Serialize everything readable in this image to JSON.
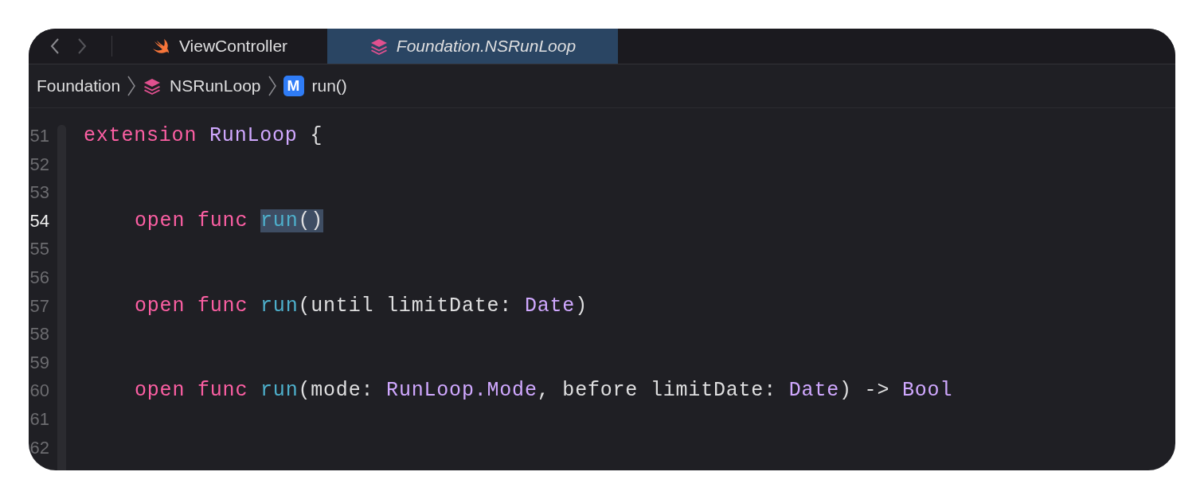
{
  "tab_bar": {
    "tabs": [
      {
        "label": "ViewController",
        "kind": "swift",
        "selected": false,
        "preview": false
      },
      {
        "label": "Foundation.NSRunLoop",
        "kind": "module",
        "selected": true,
        "preview": true
      }
    ]
  },
  "breadcrumbs": [
    {
      "label": "Foundation",
      "kind": "group"
    },
    {
      "label": "NSRunLoop",
      "kind": "module"
    },
    {
      "label": "run()",
      "kind": "method",
      "badge": "M"
    }
  ],
  "editor": {
    "lines": [
      {
        "number": "51",
        "current": false,
        "tokens": [
          {
            "text": "extension ",
            "kind": "keyword",
            "selected": false
          },
          {
            "text": "RunLoop ",
            "kind": "type",
            "selected": false
          },
          {
            "text": "{",
            "kind": "plain",
            "selected": false
          }
        ]
      },
      {
        "number": "52",
        "current": false
      },
      {
        "number": "53",
        "current": false
      },
      {
        "number": "54",
        "current": true,
        "tokens": [
          {
            "text": "open ",
            "kind": "keyword",
            "selected": false
          },
          {
            "text": "func ",
            "kind": "keyword",
            "selected": false
          },
          {
            "text": "run",
            "kind": "function",
            "selected": true
          },
          {
            "text": "()",
            "kind": "plain",
            "selected": true
          }
        ]
      },
      {
        "number": "55",
        "current": false
      },
      {
        "number": "56",
        "current": false
      },
      {
        "number": "57",
        "current": false,
        "tokens": [
          {
            "text": "open ",
            "kind": "keyword",
            "selected": false
          },
          {
            "text": "func ",
            "kind": "keyword",
            "selected": false
          },
          {
            "text": "run",
            "kind": "function",
            "selected": false
          },
          {
            "text": "(until limitDate: ",
            "kind": "plain",
            "selected": false
          },
          {
            "text": "Date",
            "kind": "type",
            "selected": false
          },
          {
            "text": ")",
            "kind": "plain",
            "selected": false
          }
        ]
      },
      {
        "number": "58",
        "current": false
      },
      {
        "number": "59",
        "current": false
      },
      {
        "number": "60",
        "current": false,
        "tokens": [
          {
            "text": "open ",
            "kind": "keyword",
            "selected": false
          },
          {
            "text": "func ",
            "kind": "keyword",
            "selected": false
          },
          {
            "text": "run",
            "kind": "function",
            "selected": false
          },
          {
            "text": "(mode: ",
            "kind": "plain",
            "selected": false
          },
          {
            "text": "RunLoop.Mode",
            "kind": "type",
            "selected": false
          },
          {
            "text": ", before limitDate: ",
            "kind": "plain",
            "selected": false
          },
          {
            "text": "Date",
            "kind": "type",
            "selected": false
          },
          {
            "text": ") -> ",
            "kind": "plain",
            "selected": false
          },
          {
            "text": "Bool",
            "kind": "type",
            "selected": false
          }
        ]
      },
      {
        "number": "61",
        "current": false
      },
      {
        "number": "62",
        "current": false
      }
    ]
  }
}
